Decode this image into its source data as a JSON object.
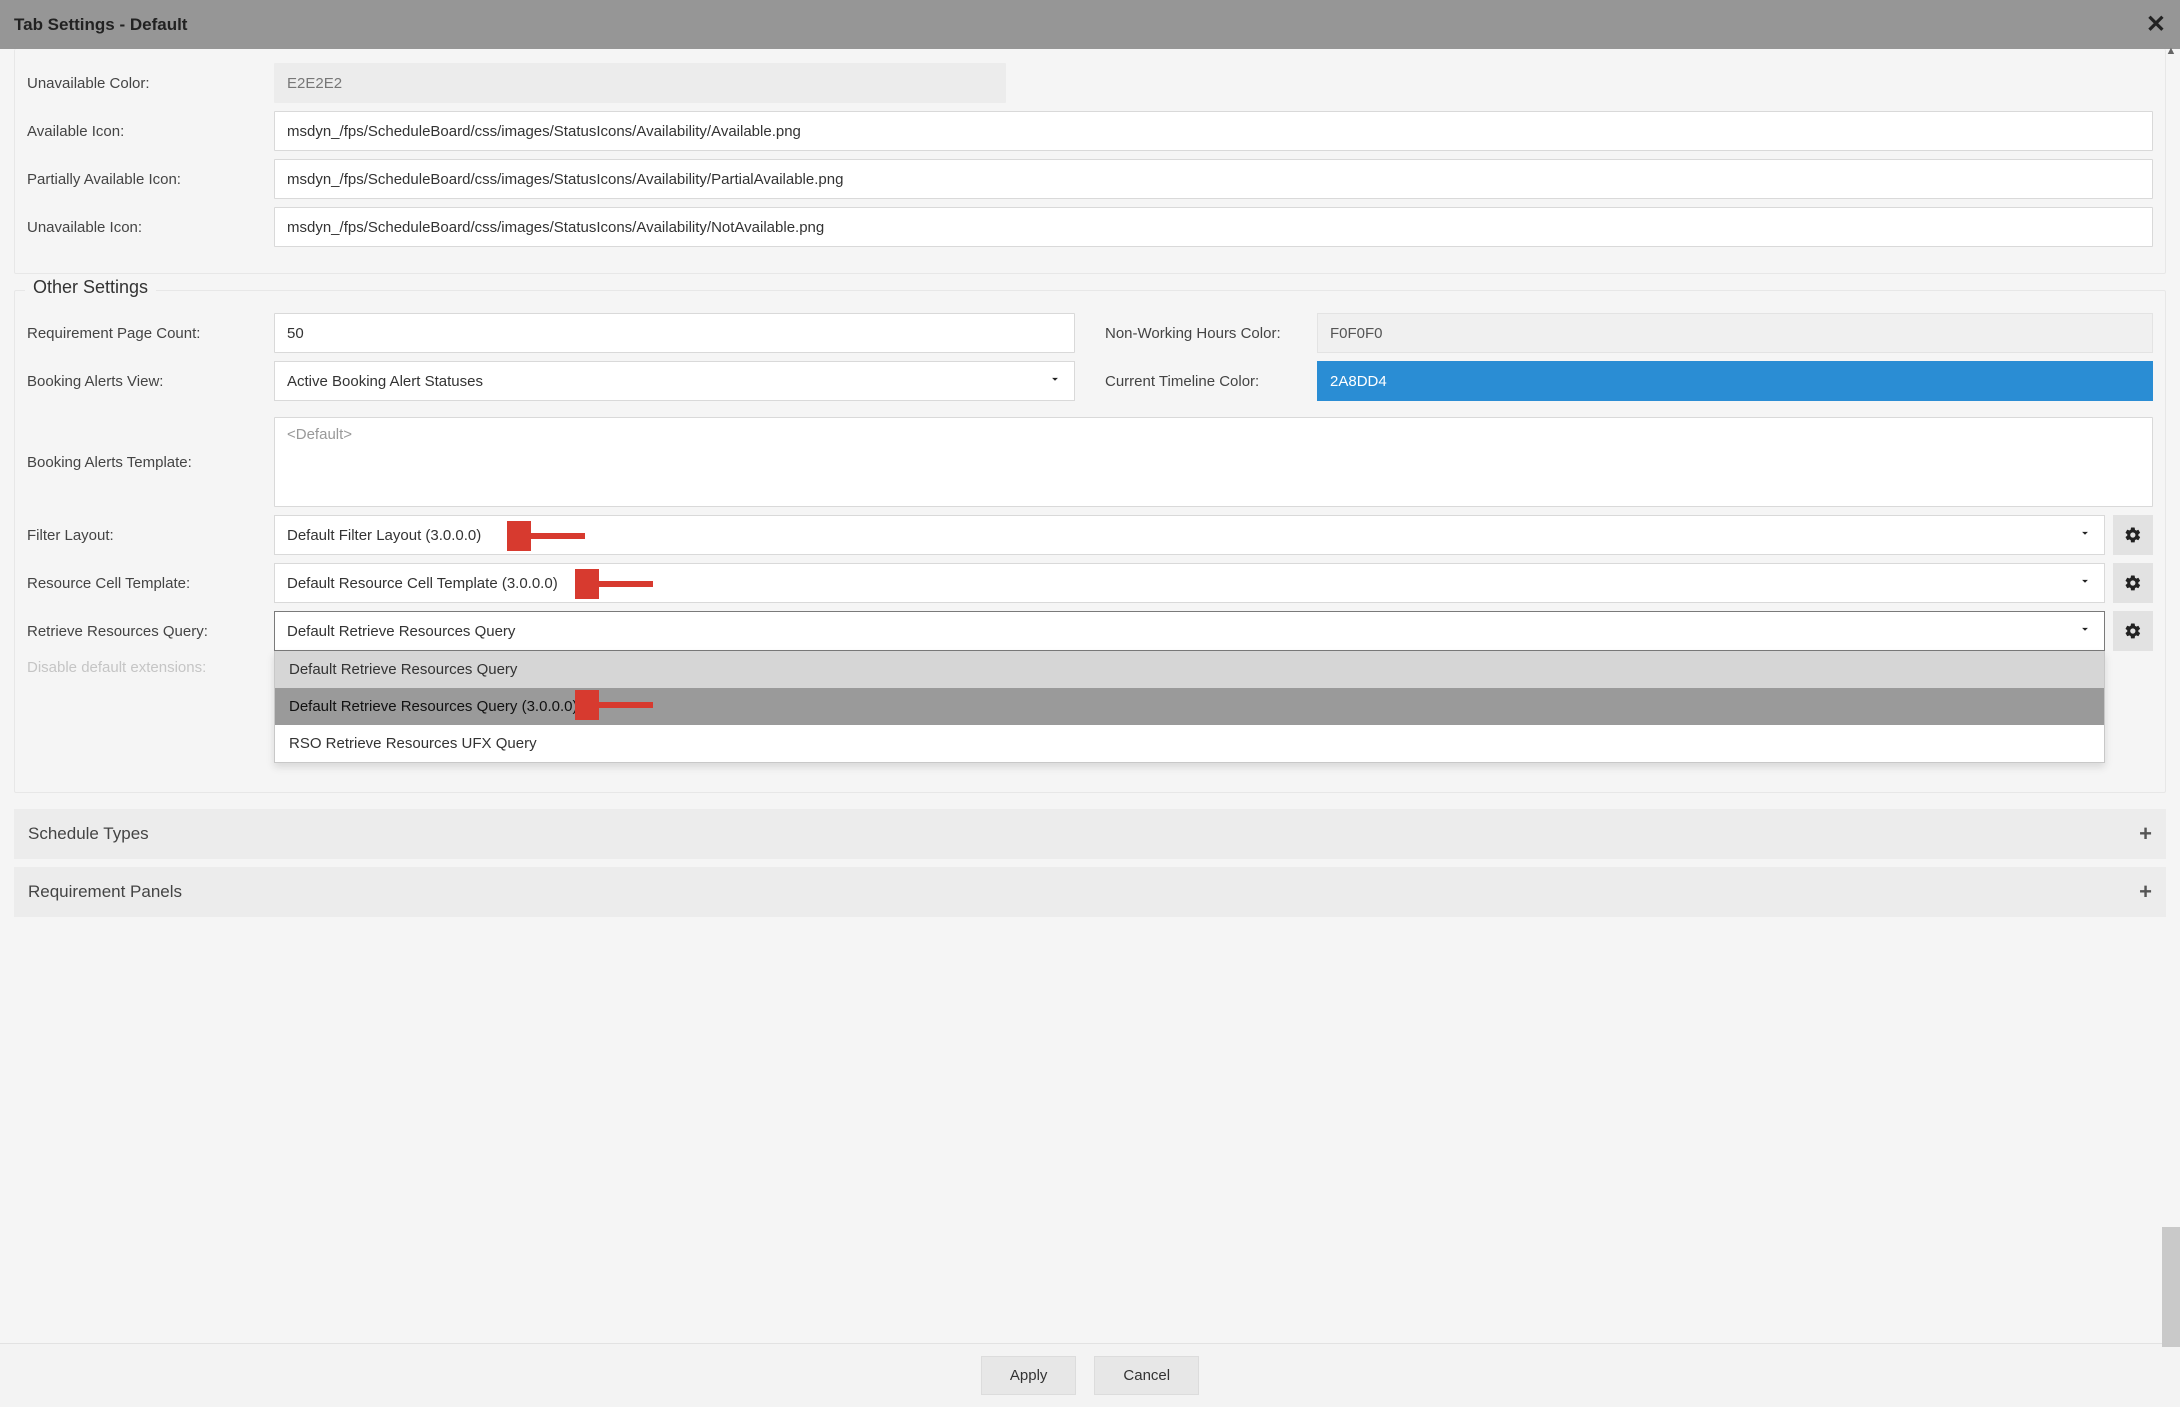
{
  "title": "Tab Settings - Default",
  "top_fields": {
    "unavailable_color": {
      "label": "Unavailable Color:",
      "value": "E2E2E2"
    },
    "available_icon": {
      "label": "Available Icon:",
      "value": "msdyn_/fps/ScheduleBoard/css/images/StatusIcons/Availability/Available.png"
    },
    "partially_icon": {
      "label": "Partially Available Icon:",
      "value": "msdyn_/fps/ScheduleBoard/css/images/StatusIcons/Availability/PartialAvailable.png"
    },
    "unavailable_icon": {
      "label": "Unavailable Icon:",
      "value": "msdyn_/fps/ScheduleBoard/css/images/StatusIcons/Availability/NotAvailable.png"
    }
  },
  "other_settings": {
    "legend": "Other Settings",
    "req_page_count": {
      "label": "Requirement Page Count:",
      "value": "50"
    },
    "nonworking_color": {
      "label": "Non-Working Hours Color:",
      "value": "F0F0F0"
    },
    "booking_alerts_view": {
      "label": "Booking Alerts View:",
      "value": "Active Booking Alert Statuses"
    },
    "timeline_color": {
      "label": "Current Timeline Color:",
      "value": "2A8DD4"
    },
    "booking_alerts_template": {
      "label": "Booking Alerts Template:",
      "placeholder": "<Default>"
    },
    "filter_layout": {
      "label": "Filter Layout:",
      "value": "Default Filter Layout (3.0.0.0)"
    },
    "resource_cell_template": {
      "label": "Resource Cell Template:",
      "value": "Default Resource Cell Template (3.0.0.0)"
    },
    "retrieve_resources_query": {
      "label": "Retrieve Resources Query:",
      "value": "Default Retrieve Resources Query",
      "options": [
        "Default Retrieve Resources Query",
        "Default Retrieve Resources Query (3.0.0.0)",
        "RSO Retrieve Resources UFX Query"
      ]
    },
    "disable_ext": {
      "label": "Disable default extensions:"
    }
  },
  "sections": {
    "schedule_types": "Schedule Types",
    "requirement_panels": "Requirement Panels"
  },
  "footer": {
    "apply": "Apply",
    "cancel": "Cancel"
  }
}
